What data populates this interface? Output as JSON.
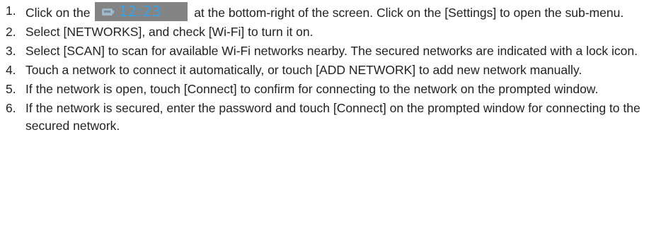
{
  "status_chip": {
    "time": "12:23",
    "icon": "battery-icon",
    "text_color": "#3aa1e6",
    "background": "#848484"
  },
  "steps": [
    {
      "number": "1.",
      "before": "Click on the",
      "after": "at the bottom-right of the screen. Click on the [Settings] to open the sub-menu."
    },
    {
      "number": "2.",
      "text": "Select [NETWORKS], and check [Wi-Fi] to turn it on."
    },
    {
      "number": "3.",
      "text": "Select [SCAN] to scan for available Wi-Fi networks nearby. The secured networks are indicated with a lock icon."
    },
    {
      "number": "4.",
      "text": "Touch a network to connect it automatically, or touch [ADD NETWORK] to add new network manually."
    },
    {
      "number": "5.",
      "text": "If the network is open, touch [Connect] to confirm for connecting to the network on the prompted window."
    },
    {
      "number": "6.",
      "text": "If the network is secured, enter the password and touch [Connect] on the prompted window for connecting to the secured network."
    }
  ]
}
